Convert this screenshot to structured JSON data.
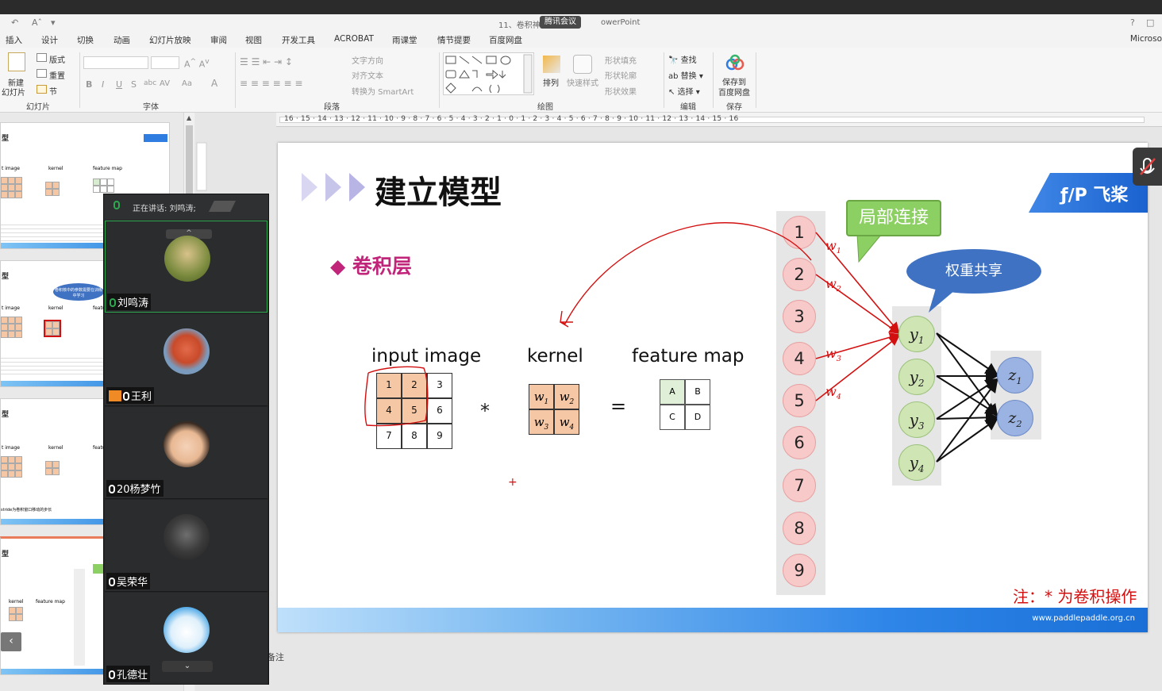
{
  "titlebar": {
    "doc_title": "11、卷积神",
    "meeting_badge": "腾讯会议",
    "app_suffix": "owerPoint",
    "undo_label": "Aˆ"
  },
  "menu": {
    "tabs": [
      "插入",
      "设计",
      "切换",
      "动画",
      "幻灯片放映",
      "审阅",
      "视图",
      "开发工具",
      "ACROBAT",
      "雨课堂",
      "情节提要",
      "百度网盘"
    ],
    "right_label": "Microso"
  },
  "ribbon": {
    "slides_group": {
      "new_slide": "新建",
      "new_slide2": "幻灯片",
      "layout": "版式",
      "reset": "重置",
      "section": "节",
      "label": "幻灯片"
    },
    "font_group": {
      "label": "字体"
    },
    "paragraph_group": {
      "text_direction": "文字方向",
      "align_text": "对齐文本",
      "convert_smartart": "转换为 SmartArt",
      "label": "段落"
    },
    "drawing_group": {
      "arrange": "排列",
      "quick_styles": "快速样式",
      "shape_fill": "形状填充",
      "shape_outline": "形状轮廓",
      "shape_effects": "形状效果",
      "label": "绘图"
    },
    "editing_group": {
      "find": "查找",
      "replace": "替换",
      "select": "选择",
      "label": "编辑"
    },
    "save_group": {
      "save_to": "保存到",
      "baidu": "百度网盘",
      "label": "保存"
    }
  },
  "ruler": {
    "ticks": "16 · 15 · 14 · 13 · 12 · 11 · 10 · 9 · 8 · 7 · 6 · 5 · 4 · 3 · 2 · 1 · 0 · 1 · 2 · 3 · 4 · 5 · 6 · 7 · 8 · 9 · 10 · 11 · 12 · 13 · 14 · 15 · 16"
  },
  "thumbnails": [
    {
      "title": "型",
      "l1": "t image",
      "l2": "kernel",
      "l3": "feature map"
    },
    {
      "title": "型",
      "l1": "t image",
      "l2": "kernel",
      "l3": "featu",
      "bubble": "卷积核中的参数需要在训练中学习"
    },
    {
      "title": "型",
      "l1": "t image",
      "l2": "kernel",
      "l3": "featu",
      "note": "stride为卷积窗口移动的步长"
    },
    {
      "title": "型",
      "l1": "kernel",
      "l2": "feature map"
    }
  ],
  "meeting": {
    "speaking": "正在讲话: 刘鸣涛;",
    "participants": [
      {
        "name": "刘鸣涛",
        "active": true
      },
      {
        "name": "王利",
        "active": false
      },
      {
        "name": "20杨梦竹",
        "active": false
      },
      {
        "name": "吴荣华",
        "active": false
      },
      {
        "name": "孔德壮",
        "active": false
      }
    ]
  },
  "slide": {
    "title": "建立模型",
    "subtitle": "◆ 卷积层",
    "input_label": "input image",
    "kernel_label": "kernel",
    "feature_label": "feature map",
    "input_cells": [
      "1",
      "2",
      "3",
      "4",
      "5",
      "6",
      "7",
      "8",
      "9"
    ],
    "feature_cells": [
      "A",
      "B",
      "C",
      "D"
    ],
    "op_conv": "*",
    "op_eq": "=",
    "nodes": [
      "1",
      "2",
      "3",
      "4",
      "5",
      "6",
      "7",
      "8",
      "9"
    ],
    "local_box": "局部连接",
    "share_bubble": "权重共享",
    "note": "注：* 为卷积操作",
    "url": "www.paddlepaddle.org.cn",
    "logo": "飞桨",
    "pencil_mark": "+"
  },
  "notes_label": "备注",
  "colors": {
    "accent_red": "#d31010",
    "subtitle": "#c1257a",
    "green_box": "#8ccf62",
    "blue_bubble": "#3f72c2"
  }
}
